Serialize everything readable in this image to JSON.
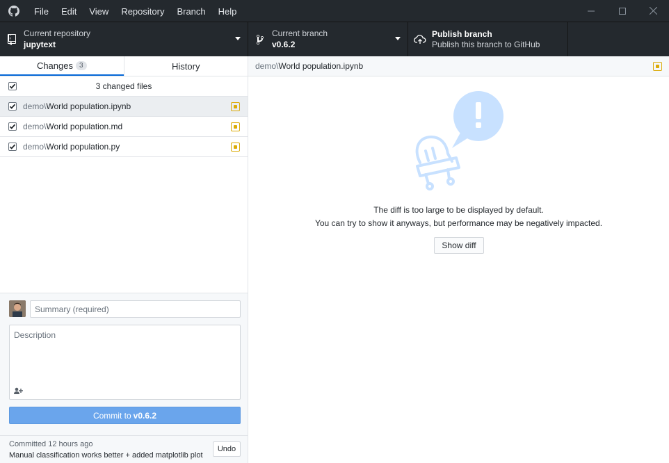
{
  "menu": {
    "items": [
      {
        "label": "File"
      },
      {
        "label": "Edit"
      },
      {
        "label": "View"
      },
      {
        "label": "Repository"
      },
      {
        "label": "Branch"
      },
      {
        "label": "Help"
      }
    ]
  },
  "icons": {
    "app": "github-logo-icon",
    "minimize": "minimize-icon",
    "maximize": "maximize-icon",
    "close": "close-icon",
    "repo": "repo-icon",
    "branch": "git-branch-icon",
    "publish": "cloud-upload-icon",
    "coauthor": "add-person-icon"
  },
  "toolbar": {
    "repo": {
      "label": "Current repository",
      "value": "jupytext"
    },
    "branch": {
      "label": "Current branch",
      "value": "v0.6.2"
    },
    "publish": {
      "label": "Publish branch",
      "sub": "Publish this branch to GitHub"
    }
  },
  "tabs": {
    "changes": {
      "label": "Changes",
      "count": "3"
    },
    "history": {
      "label": "History"
    }
  },
  "changes": {
    "header": "3 changed files",
    "files": [
      {
        "dir": "demo\\",
        "name": "World population.ipynb",
        "status": "modified"
      },
      {
        "dir": "demo\\",
        "name": "World population.md",
        "status": "modified"
      },
      {
        "dir": "demo\\",
        "name": "World population.py",
        "status": "modified"
      }
    ]
  },
  "commit": {
    "summary_placeholder": "Summary (required)",
    "summary_value": "",
    "description_placeholder": "Description",
    "button_prefix": "Commit to",
    "button_branch": "v0.6.2"
  },
  "last_commit": {
    "meta": "Committed 12 hours ago",
    "message": "Manual classification works better + added matplotlib plot",
    "undo_label": "Undo"
  },
  "diff": {
    "path_dir": "demo\\",
    "path_name": "World population.ipynb",
    "line1": "The diff is too large to be displayed by default.",
    "line2": "You can try to show it anyways, but performance may be negatively impacted.",
    "show_diff_label": "Show diff"
  },
  "colors": {
    "titlebar": "#24292e",
    "accent_blue": "#0366d6",
    "commit_button": "#6aa5ec",
    "modified": "#dbab09",
    "illustration": "#c8e1ff"
  }
}
